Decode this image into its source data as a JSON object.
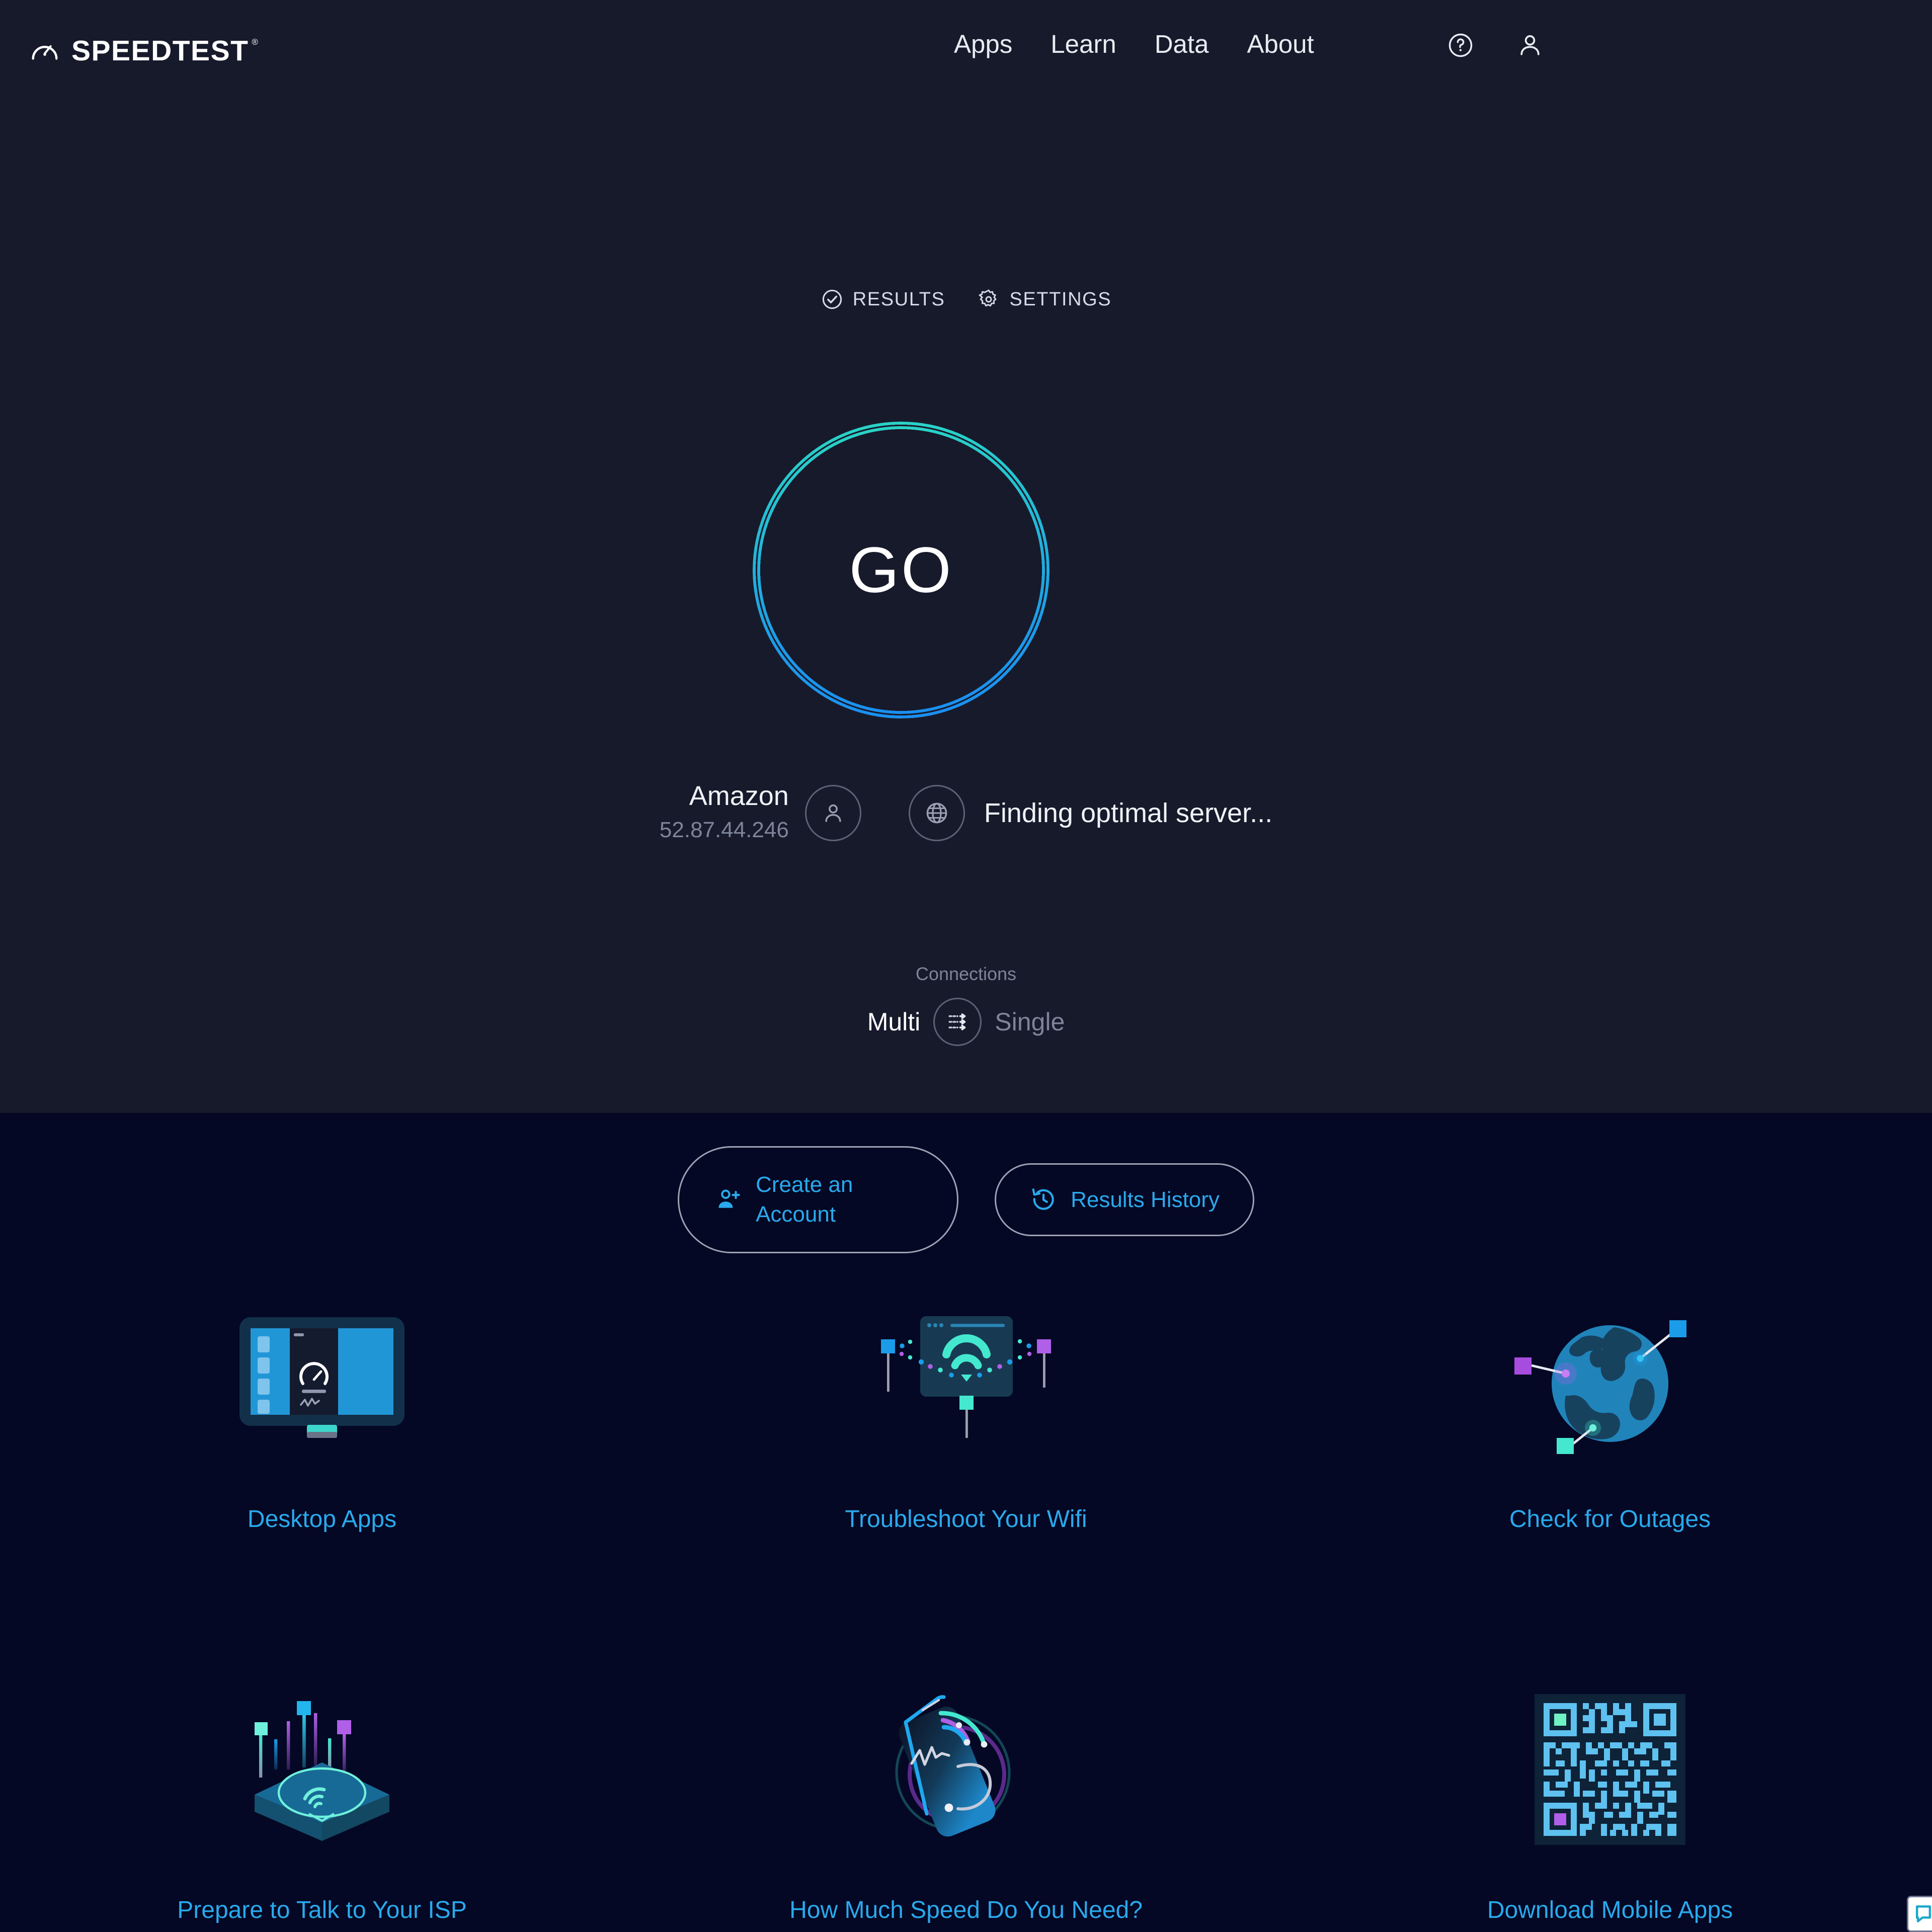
{
  "header": {
    "brand": "SPEEDTEST",
    "logo_icon": "speedometer-icon",
    "nav": [
      {
        "label": "Apps"
      },
      {
        "label": "Learn"
      },
      {
        "label": "Data"
      },
      {
        "label": "About"
      }
    ],
    "help_icon": "question-circle-icon",
    "account_icon": "person-icon"
  },
  "tabs": [
    {
      "label": "RESULTS",
      "icon": "check-circle-icon"
    },
    {
      "label": "SETTINGS",
      "icon": "gear-icon"
    }
  ],
  "go_button": {
    "label": "GO",
    "ring_gradient_from": "#2ad6c4",
    "ring_gradient_to": "#1a8ef2"
  },
  "connection": {
    "isp_name": "Amazon",
    "ip_address": "52.87.44.246",
    "isp_icon": "person-icon",
    "server_icon": "globe-icon",
    "server_status": "Finding optimal server..."
  },
  "connections_toggle": {
    "label": "Connections",
    "multi_label": "Multi",
    "single_label": "Single",
    "selected": "Multi",
    "knob_icon": "multi-arrows-icon"
  },
  "cta": [
    {
      "label": "Create an Account",
      "icon": "person-add-icon"
    },
    {
      "label": "Results History",
      "icon": "history-clock-icon"
    }
  ],
  "features": [
    {
      "label": "Desktop Apps",
      "icon": "desktop-monitor-icon"
    },
    {
      "label": "Troubleshoot Your Wifi",
      "icon": "wifi-window-icon"
    },
    {
      "label": "Check for Outages",
      "icon": "globe-markers-icon"
    },
    {
      "label": "Prepare to Talk to Your ISP",
      "icon": "router-antennas-icon"
    },
    {
      "label": "How Much Speed Do You Need?",
      "icon": "phone-signal-icon"
    },
    {
      "label": "Download Mobile Apps",
      "icon": "qr-code-icon"
    }
  ],
  "colors": {
    "hero_bg": "#171a2b",
    "lower_bg": "#040824",
    "link_blue": "#2aa9ec",
    "muted_text": "#7d8499",
    "white_text": "#ffffff",
    "accent_teal": "#2ad6c4",
    "accent_purple": "#b05fe8"
  },
  "chat_widget": {
    "icon": "chat-bubble-icon"
  }
}
